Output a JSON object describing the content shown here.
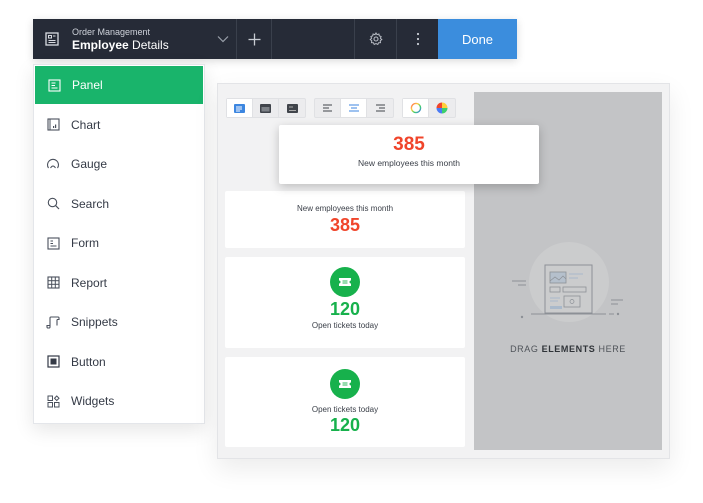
{
  "topbar": {
    "app_icon": "form-document-icon",
    "subtitle": "Order Management",
    "title_bold": "Employee",
    "title_rest": " Details",
    "dropdown_icon": "chevron-down-icon",
    "add_icon": "plus-icon",
    "settings_icon": "gear-icon",
    "more_icon": "vertical-dots-icon",
    "done_label": "Done",
    "done_color": "#3b8ddd"
  },
  "sidebar": {
    "active_color": "#19b46b",
    "items": [
      {
        "label": "Panel",
        "icon": "panel-icon",
        "active": true
      },
      {
        "label": "Chart",
        "icon": "chart-icon",
        "active": false
      },
      {
        "label": "Gauge",
        "icon": "gauge-icon",
        "active": false
      },
      {
        "label": "Search",
        "icon": "search-icon",
        "active": false
      },
      {
        "label": "Form",
        "icon": "form-icon",
        "active": false
      },
      {
        "label": "Report",
        "icon": "table-grid-icon",
        "active": false
      },
      {
        "label": "Snippets",
        "icon": "scroll-icon",
        "active": false
      },
      {
        "label": "Button",
        "icon": "button-square-icon",
        "active": false
      },
      {
        "label": "Widgets",
        "icon": "widgets-icon",
        "active": false
      }
    ]
  },
  "toolbar": {
    "style_buttons": [
      "style-light-icon",
      "style-dark-header-icon",
      "style-dark-icon"
    ],
    "align_buttons": [
      "align-left-icon",
      "align-center-icon",
      "align-right-icon"
    ],
    "color_buttons": [
      "color-outline-icon",
      "color-fill-icon"
    ],
    "selected_style": 0,
    "selected_align": 1,
    "selected_color": 0
  },
  "floating_card": {
    "value": "385",
    "label": "New employees this month"
  },
  "cards": [
    {
      "label": "New employees this month",
      "value": "385",
      "value_color": "#f0452b"
    },
    {
      "icon": "ticket-icon",
      "value": "120",
      "label": "Open tickets today",
      "value_color": "#17b14c"
    },
    {
      "icon": "ticket-icon",
      "label": "Open tickets today",
      "value": "120",
      "value_color": "#17b14c"
    }
  ],
  "dropzone": {
    "text_pre": "DRAG ",
    "text_bold": "ELEMENTS",
    "text_post": " HERE",
    "illustration": "layout-placeholder-icon"
  }
}
